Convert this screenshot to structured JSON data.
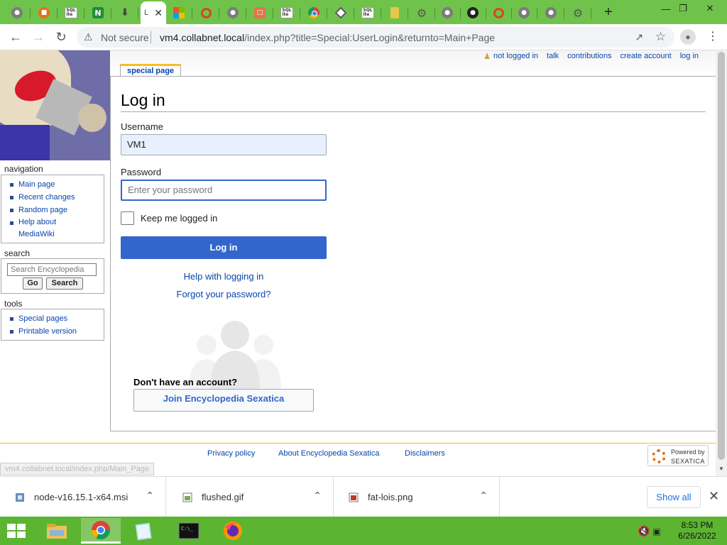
{
  "browser": {
    "active_tab_title": "L",
    "not_secure_label": "Not secure",
    "url_host": "vm4.collabnet.local",
    "url_path": "/index.php?title=Special:UserLogin&returnto=Main+Page"
  },
  "tabs_favicons": [
    "grey-globe",
    "orange-badge",
    "sqlite",
    "n-green",
    "download",
    "active",
    "microsoft",
    "orange-ring",
    "globe",
    "image-doc",
    "sqlite",
    "chrome",
    "diamond",
    "sqlite",
    "book",
    "gear",
    "globe",
    "dark-emblem",
    "orange-ring",
    "globe",
    "globe",
    "gear"
  ],
  "personal": {
    "not_logged_in": "not logged in",
    "talk": "talk",
    "contributions": "contributions",
    "create_account": "create account",
    "log_in": "log in"
  },
  "page_tab": "special page",
  "heading": "Log in",
  "form": {
    "username_label": "Username",
    "username_value": "VM1",
    "password_label": "Password",
    "password_placeholder": "Enter your password",
    "keep_logged_in": "Keep me logged in",
    "login_button": "Log in",
    "help_link": "Help with logging in",
    "forgot_link": "Forgot your password?",
    "no_account": "Don't have an account?",
    "join_button": "Join Encyclopedia Sexatica"
  },
  "sidebar": {
    "navigation_heading": "navigation",
    "navigation_items": [
      "Main page",
      "Recent changes",
      "Random page",
      "Help about MediaWiki"
    ],
    "search_heading": "search",
    "search_placeholder": "Search Encyclopedia",
    "go_button": "Go",
    "search_button": "Search",
    "tools_heading": "tools",
    "tools_items": [
      "Special pages",
      "Printable version"
    ]
  },
  "footer": {
    "privacy": "Privacy policy",
    "about": "About Encyclopedia Sexatica",
    "disclaimers": "Disclaimers",
    "powered_by": "Powered by",
    "powered_name": "SEXATICA"
  },
  "status_url": "vm4.collabnet.local/index.php/Main_Page",
  "downloads": {
    "items": [
      "node-v16.15.1-x64.msi",
      "flushed.gif",
      "fat-lois.png"
    ],
    "show_all": "Show all"
  },
  "taskbar": {
    "time": "8:53 PM",
    "date": "6/26/2022"
  }
}
